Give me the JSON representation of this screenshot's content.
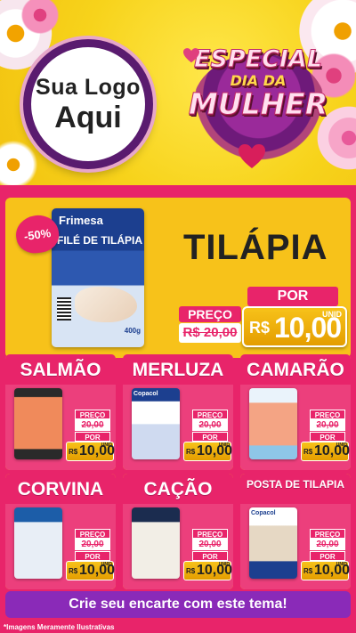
{
  "header": {
    "logo_line1": "Sua Logo",
    "logo_line2": "Aqui",
    "title_line1": "ESPECIAL",
    "title_line2": "DIA DA",
    "title_line3": "MULHER"
  },
  "hero": {
    "product_name": "TILÁPIA",
    "discount": "-50%",
    "pack_brand": "Frimesa",
    "pack_name": "FILÉ DE TILÁPIA",
    "pack_weight": "400g",
    "old_label": "PREÇO",
    "old_price": "R$ 20,00",
    "new_label": "POR",
    "currency": "R$",
    "new_price": "10,00",
    "unit": "UNID"
  },
  "products": [
    {
      "name": "SALMÃO",
      "old_label": "PREÇO",
      "old_price": "20,00",
      "new_label": "POR",
      "currency": "R$",
      "new_price": "10,00",
      "unit": "UNID"
    },
    {
      "name": "MERLUZA",
      "old_label": "PREÇO",
      "old_price": "20,00",
      "new_label": "POR",
      "currency": "R$",
      "new_price": "10,00",
      "unit": "UNID",
      "pack_brand": "Copacol"
    },
    {
      "name": "CAMARÃO",
      "old_label": "PREÇO",
      "old_price": "20,00",
      "new_label": "POR",
      "currency": "R$",
      "new_price": "10,00",
      "unit": "UNID"
    },
    {
      "name": "CORVINA",
      "old_label": "PREÇO",
      "old_price": "20,00",
      "new_label": "POR",
      "currency": "R$",
      "new_price": "10,00",
      "unit": "UNID"
    },
    {
      "name": "CAÇÃO",
      "old_label": "PREÇO",
      "old_price": "20,00",
      "new_label": "POR",
      "currency": "R$",
      "new_price": "10,00",
      "unit": "UNID"
    },
    {
      "name": "POSTA DE TILAPIA",
      "old_label": "PREÇO",
      "old_price": "20,00",
      "new_label": "POR",
      "currency": "R$",
      "new_price": "10,00",
      "unit": "UNID",
      "pack_brand": "Copacol"
    }
  ],
  "cta_label": "Crie seu encarte com este tema!",
  "disclaimer": "*Imagens Meramente Ilustrativas",
  "colors": {
    "pink": "#e8246a",
    "yellow": "#f7c21a",
    "purple": "#8a2ab8",
    "dark_purple": "#5a1b6f"
  }
}
